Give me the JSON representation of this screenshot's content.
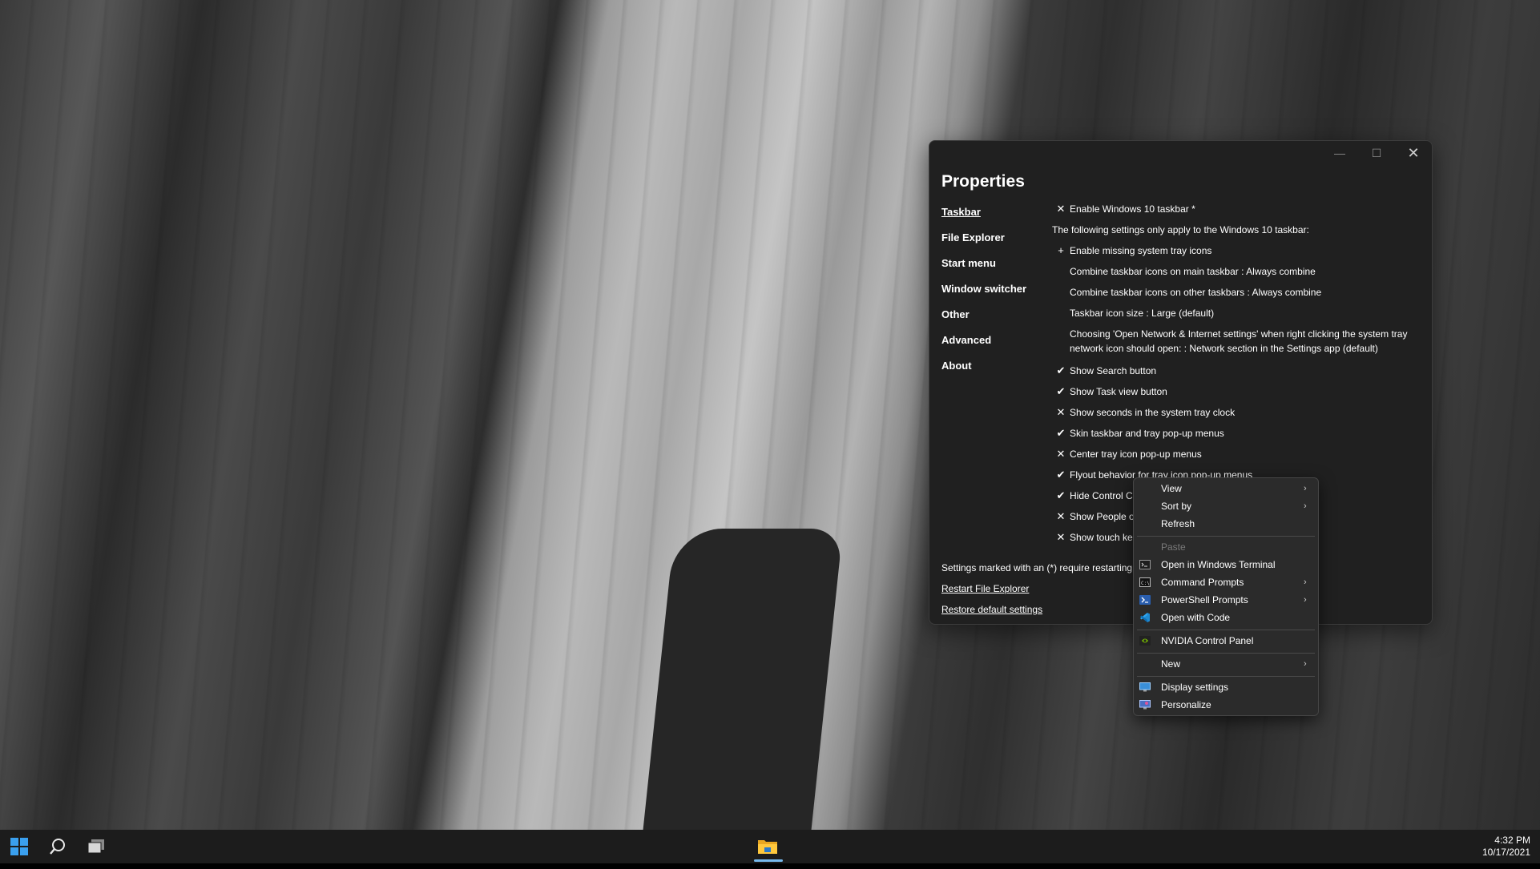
{
  "window": {
    "title": "Properties",
    "controls": {
      "minimize": "—",
      "maximize": "☐",
      "close": "✕"
    }
  },
  "nav": [
    {
      "label": "Taskbar",
      "active": true
    },
    {
      "label": "File Explorer"
    },
    {
      "label": "Start menu"
    },
    {
      "label": "Window switcher"
    },
    {
      "label": "Other"
    },
    {
      "label": "Advanced"
    },
    {
      "label": "About"
    }
  ],
  "settings": [
    {
      "mark": "✕",
      "text": "Enable Windows 10 taskbar *"
    },
    {
      "mark": "",
      "text": "The following settings only apply to the Windows 10 taskbar:",
      "note": true
    },
    {
      "mark": "+",
      "text": "Enable missing system tray icons"
    },
    {
      "mark": "",
      "text": "Combine taskbar icons on main taskbar : Always combine"
    },
    {
      "mark": "",
      "text": "Combine taskbar icons on other taskbars : Always combine"
    },
    {
      "mark": "",
      "text": "Taskbar icon size : Large (default)"
    },
    {
      "mark": "",
      "text": "Choosing 'Open Network & Internet settings' when right clicking the system tray network icon should open: : Network section in the Settings app (default)",
      "tall": true
    },
    {
      "mark": "✔",
      "text": "Show Search button"
    },
    {
      "mark": "✔",
      "text": "Show Task view button"
    },
    {
      "mark": "✕",
      "text": "Show seconds in the system tray clock"
    },
    {
      "mark": "✔",
      "text": "Skin taskbar and tray pop-up menus"
    },
    {
      "mark": "✕",
      "text": "Center tray icon pop-up menus"
    },
    {
      "mark": "✔",
      "text": "Flyout behavior for tray icon pop-up menus"
    },
    {
      "mark": "✔",
      "text": "Hide Control C"
    },
    {
      "mark": "✕",
      "text": "Show People o"
    },
    {
      "mark": "✕",
      "text": "Show touch ke"
    }
  ],
  "footer": {
    "note": "Settings marked with an (*) require restarting t",
    "restart_link": "Restart File Explorer",
    "restore_link": "Restore default settings"
  },
  "context_menu": {
    "view": "View",
    "sort_by": "Sort by",
    "refresh": "Refresh",
    "paste": "Paste",
    "open_terminal": "Open in Windows Terminal",
    "command_prompts": "Command Prompts",
    "powershell_prompts": "PowerShell Prompts",
    "open_with_code": "Open with Code",
    "nvidia": "NVIDIA Control Panel",
    "new": "New",
    "display_settings": "Display settings",
    "personalize": "Personalize",
    "submenu_arrow": "›"
  },
  "taskbar": {
    "time": "4:32 PM",
    "date": "10/17/2021"
  },
  "colors": {
    "accent": "#0078d4",
    "window_bg": "#202020",
    "menu_bg": "#2b2b2b"
  }
}
